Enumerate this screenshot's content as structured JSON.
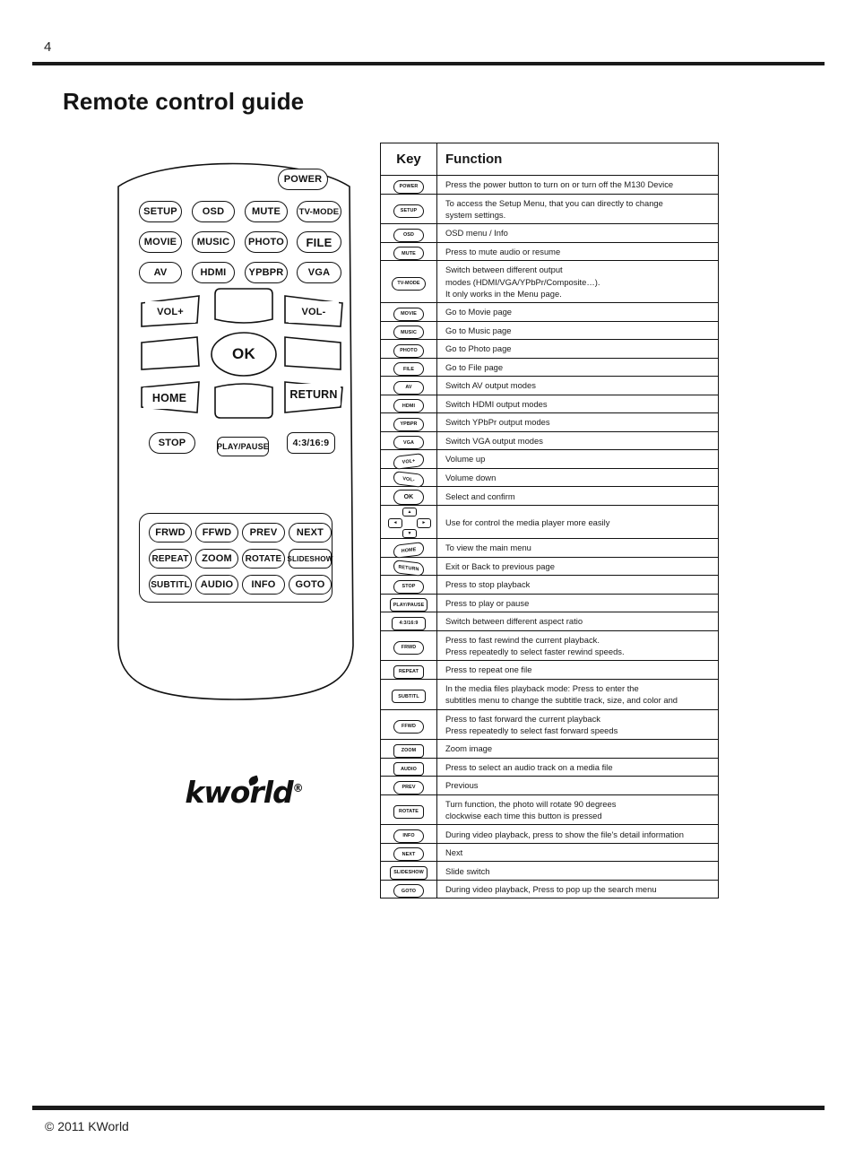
{
  "header": {
    "page_number": "4",
    "title": "Remote control guide"
  },
  "footer": {
    "copyright": "© 2011 KWorld"
  },
  "remote": {
    "brand": "kworld",
    "registered_mark": "®",
    "buttons": [
      {
        "label": "POWER",
        "name": "power"
      },
      {
        "label": "SETUP",
        "name": "setup"
      },
      {
        "label": "OSD",
        "name": "osd"
      },
      {
        "label": "MUTE",
        "name": "mute"
      },
      {
        "label": "TV-MODE",
        "name": "tv-mode"
      },
      {
        "label": "MOVIE",
        "name": "movie"
      },
      {
        "label": "MUSIC",
        "name": "music"
      },
      {
        "label": "PHOTO",
        "name": "photo"
      },
      {
        "label": "FILE",
        "name": "file"
      },
      {
        "label": "AV",
        "name": "av"
      },
      {
        "label": "HDMI",
        "name": "hdmi"
      },
      {
        "label": "YPBPR",
        "name": "ypbpr"
      },
      {
        "label": "VGA",
        "name": "vga"
      },
      {
        "label": "VOL+",
        "name": "volume-up"
      },
      {
        "label": "VOL-",
        "name": "volume-down"
      },
      {
        "label": "OK",
        "name": "ok"
      },
      {
        "label": "HOME",
        "name": "home"
      },
      {
        "label": "RETURN",
        "name": "return"
      },
      {
        "label": "STOP",
        "name": "stop"
      },
      {
        "label": "PLAY/PAUSE",
        "name": "play-pause"
      },
      {
        "label": "4:3/16:9",
        "name": "aspect-ratio"
      },
      {
        "label": "FRWD",
        "name": "frwd"
      },
      {
        "label": "FFWD",
        "name": "ffwd"
      },
      {
        "label": "PREV",
        "name": "prev"
      },
      {
        "label": "NEXT",
        "name": "next"
      },
      {
        "label": "REPEAT",
        "name": "repeat"
      },
      {
        "label": "ZOOM",
        "name": "zoom"
      },
      {
        "label": "ROTATE",
        "name": "rotate"
      },
      {
        "label": "SLIDESHOW",
        "name": "slideshow"
      },
      {
        "label": "SUBTITL",
        "name": "subtitl"
      },
      {
        "label": "AUDIO",
        "name": "audio"
      },
      {
        "label": "INFO",
        "name": "info"
      },
      {
        "label": "GOTO",
        "name": "goto"
      }
    ]
  },
  "table": {
    "headers": {
      "key": "Key",
      "function": "Function"
    },
    "rows": [
      {
        "key": "POWER",
        "function": "Press the power button to turn on or turn off the M130 Device"
      },
      {
        "key": "SETUP",
        "function": "To access the Setup Menu, that you can directly to change\nsystem settings."
      },
      {
        "key": "OSD",
        "function": "OSD menu / Info"
      },
      {
        "key": "MUTE",
        "function": "Press to mute audio or resume"
      },
      {
        "key": "TV-MODE",
        "function": "Switch between different output\nmodes (HDMI/VGA/YPbPr/Composite…).\nIt only works in the Menu page."
      },
      {
        "key": "MOVIE",
        "function": "Go to Movie page"
      },
      {
        "key": "MUSIC",
        "function": "Go to Music page"
      },
      {
        "key": "PHOTO",
        "function": "Go to Photo page"
      },
      {
        "key": "FILE",
        "function": "Go to File page"
      },
      {
        "key": "AV",
        "function": "Switch AV output modes"
      },
      {
        "key": "HDMI",
        "function": "Switch HDMI output modes"
      },
      {
        "key": "YPBPR",
        "function": "Switch YPbPr output modes"
      },
      {
        "key": "VGA",
        "function": "Switch VGA output modes"
      },
      {
        "key": "VOL+",
        "function": "Volume up"
      },
      {
        "key": "VOL-",
        "function": "Volume down"
      },
      {
        "key": "OK",
        "function": "Select and confirm"
      },
      {
        "key": "DPAD",
        "function": "Use for control the media player more easily"
      },
      {
        "key": "HOME",
        "function": "To view the main menu"
      },
      {
        "key": "RETURN",
        "function": "Exit or Back to previous page"
      },
      {
        "key": "STOP",
        "function": "Press to stop playback"
      },
      {
        "key": "PLAY/PAUSE",
        "function": "Press to play or pause"
      },
      {
        "key": "4:3/16:9",
        "function": "Switch between different aspect ratio"
      },
      {
        "key": "FRWD",
        "function": "Press to fast rewind the current playback.\nPress repeatedly to select faster rewind speeds."
      },
      {
        "key": "REPEAT",
        "function": "Press to repeat one file"
      },
      {
        "key": "SUBTITL",
        "function": "In the media files playback mode: Press to enter the\nsubtitles menu to change the subtitle track, size, and color and"
      },
      {
        "key": "FFWD",
        "function": "Press to fast forward the current playback\nPress repeatedly to select fast forward speeds"
      },
      {
        "key": "ZOOM",
        "function": "Zoom image"
      },
      {
        "key": "AUDIO",
        "function": "Press to select an audio track on a media file"
      },
      {
        "key": "PREV",
        "function": "Previous"
      },
      {
        "key": "ROTATE",
        "function": "Turn function, the photo will rotate 90 degrees\nclockwise each time this button is pressed"
      },
      {
        "key": "INFO",
        "function": "During video playback, press to show the file's detail information"
      },
      {
        "key": "NEXT",
        "function": "Next"
      },
      {
        "key": "SLIDESHOW",
        "function": "Slide switch"
      },
      {
        "key": "GOTO",
        "function": "During video playback, Press to pop up the search menu"
      }
    ],
    "dpad_labels": {
      "up": "▲",
      "down": "▼",
      "left": "◄",
      "right": "►"
    }
  }
}
